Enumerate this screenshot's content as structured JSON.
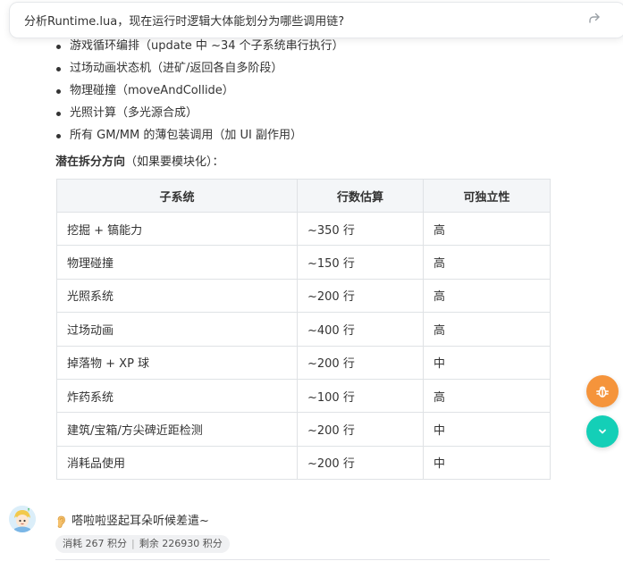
{
  "query": {
    "text": "分析Runtime.lua，现在运行时逻辑大体能划分为哪些调用链?"
  },
  "bullets": [
    "游戏循环编排（update 中 ~34 个子系统串行执行）",
    "过场动画状态机（进矿/返回各自多阶段）",
    "物理碰撞（moveAndCollide）",
    "光照计算（多光源合成）",
    "所有 GM/MM 的薄包装调用（加 UI 副作用）"
  ],
  "section": {
    "heading": "潜在拆分方向",
    "suffix": "（如果要模块化）："
  },
  "table": {
    "headers": [
      "子系统",
      "行数估算",
      "可独立性"
    ],
    "rows": [
      [
        "挖掘 + 镐能力",
        "~350 行",
        "高"
      ],
      [
        "物理碰撞",
        "~150 行",
        "高"
      ],
      [
        "光照系统",
        "~200 行",
        "高"
      ],
      [
        "过场动画",
        "~400 行",
        "高"
      ],
      [
        "掉落物 + XP 球",
        "~200 行",
        "中"
      ],
      [
        "炸药系统",
        "~100 行",
        "高"
      ],
      [
        "建筑/宝箱/方尖碑近距检测",
        "~200 行",
        "中"
      ],
      [
        "消耗品使用",
        "~200 行",
        "中"
      ]
    ]
  },
  "reply": {
    "text": "嗒啦啦竖起耳朵听候差遣~"
  },
  "usage": {
    "consumed": "消耗 267 积分",
    "separator": "|",
    "remaining": "剩余 226930 积分"
  },
  "icons": {
    "share": "share-icon",
    "bug": "bug-icon",
    "scroll_down": "chevron-down-icon",
    "ear": "ear-icon"
  },
  "colors": {
    "bug_fab": "#f5943b",
    "scroll_fab": "#14cfb7",
    "table_header_bg": "#f4f6f8",
    "table_border": "#dfe2e5"
  }
}
